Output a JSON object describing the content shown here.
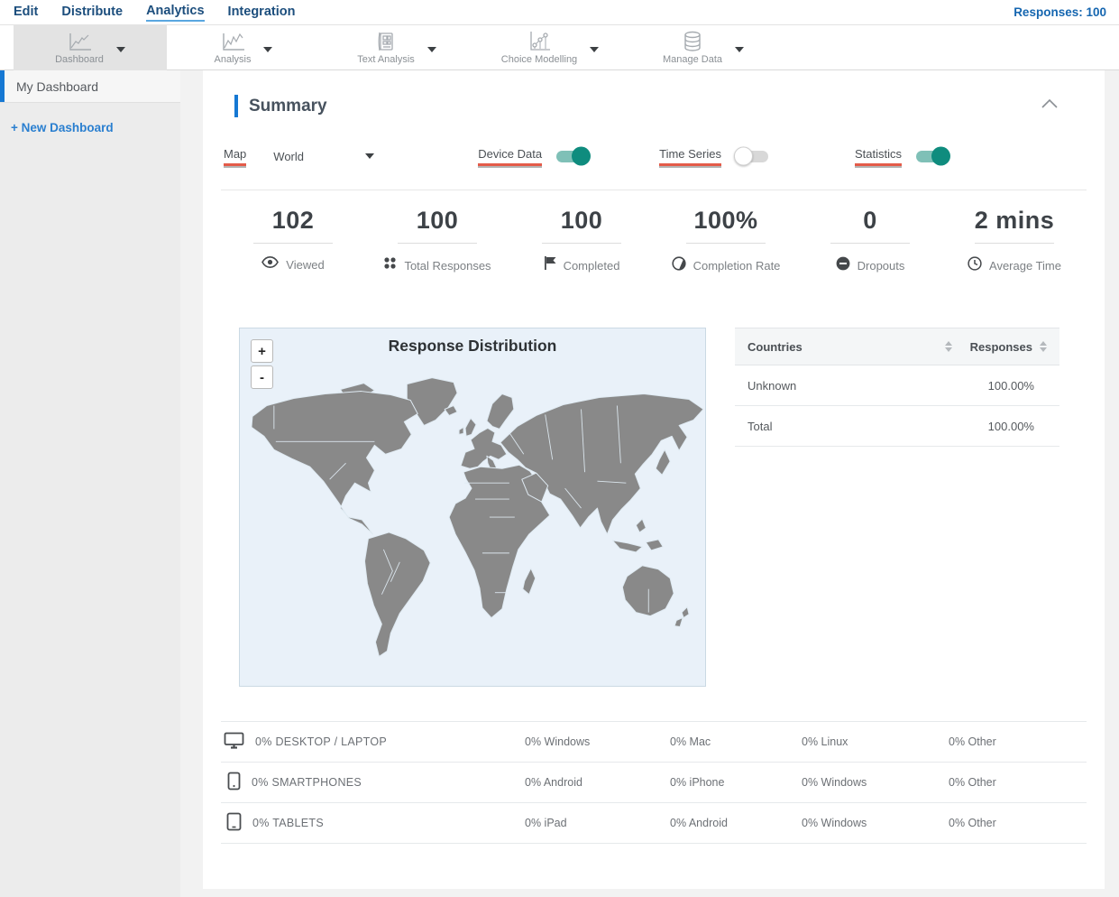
{
  "topnav": {
    "items": [
      {
        "label": "Edit",
        "active": false
      },
      {
        "label": "Distribute",
        "active": false
      },
      {
        "label": "Analytics",
        "active": true
      },
      {
        "label": "Integration",
        "active": false
      }
    ],
    "responses_label": "Responses: 100"
  },
  "toolbar": {
    "items": [
      {
        "label": "Dashboard",
        "icon": "line-chart-icon",
        "selected": true
      },
      {
        "label": "Analysis",
        "icon": "line-chart-icon",
        "selected": false
      },
      {
        "label": "Text Analysis",
        "icon": "document-grid-icon",
        "selected": false
      },
      {
        "label": "Choice Modelling",
        "icon": "scatter-chart-icon",
        "selected": false
      },
      {
        "label": "Manage Data",
        "icon": "database-icon",
        "selected": false
      }
    ]
  },
  "sidebar": {
    "items": [
      {
        "label": "My Dashboard",
        "active": true
      }
    ],
    "new_dashboard_label": "+ New Dashboard"
  },
  "summary": {
    "title": "Summary",
    "controls": {
      "map_label": "Map",
      "map_value": "World",
      "device_data_label": "Device Data",
      "device_data_on": true,
      "time_series_label": "Time Series",
      "time_series_on": false,
      "statistics_label": "Statistics",
      "statistics_on": true
    },
    "stats": [
      {
        "value": "102",
        "label": "Viewed",
        "icon": "eye-icon"
      },
      {
        "value": "100",
        "label": "Total Responses",
        "icon": "dots-grid-icon"
      },
      {
        "value": "100",
        "label": "Completed",
        "icon": "flag-icon"
      },
      {
        "value": "100%",
        "label": "Completion Rate",
        "icon": "contrast-circle-icon"
      },
      {
        "value": "0",
        "label": "Dropouts",
        "icon": "minus-circle-icon"
      },
      {
        "value": "2 mins",
        "label": "Average Time",
        "icon": "clock-icon"
      }
    ],
    "map": {
      "title": "Response Distribution",
      "zoom_in": "+",
      "zoom_out": "-"
    },
    "countries_table": {
      "headers": [
        "Countries",
        "Responses"
      ],
      "rows": [
        {
          "country": "Unknown",
          "responses": "100.00%"
        },
        {
          "country": "Total",
          "responses": "100.00%"
        }
      ]
    },
    "device_table": {
      "rows": [
        {
          "icon": "desktop-icon",
          "label": "0% DESKTOP / LAPTOP",
          "col1": "0% Windows",
          "col2": "0% Mac",
          "col3": "0% Linux",
          "col4": "0% Other"
        },
        {
          "icon": "smartphone-icon",
          "label": "0% SMARTPHONES",
          "col1": "0% Android",
          "col2": "0% iPhone",
          "col3": "0% Windows",
          "col4": "0% Other"
        },
        {
          "icon": "tablet-icon",
          "label": "0% TABLETS",
          "col1": "0% iPad",
          "col2": "0% Android",
          "col3": "0% Windows",
          "col4": "0% Other"
        }
      ]
    }
  },
  "colors": {
    "accent_blue": "#1678d3",
    "nav_blue": "#1c4e7d",
    "active_underline": "#5aa7e0",
    "toggle_on_knob": "#0f8c7e",
    "toggle_on_track": "#7fc0b7",
    "red_underline": "#e45b49",
    "map_background": "#e9f1f9",
    "land_gray": "#898989"
  }
}
